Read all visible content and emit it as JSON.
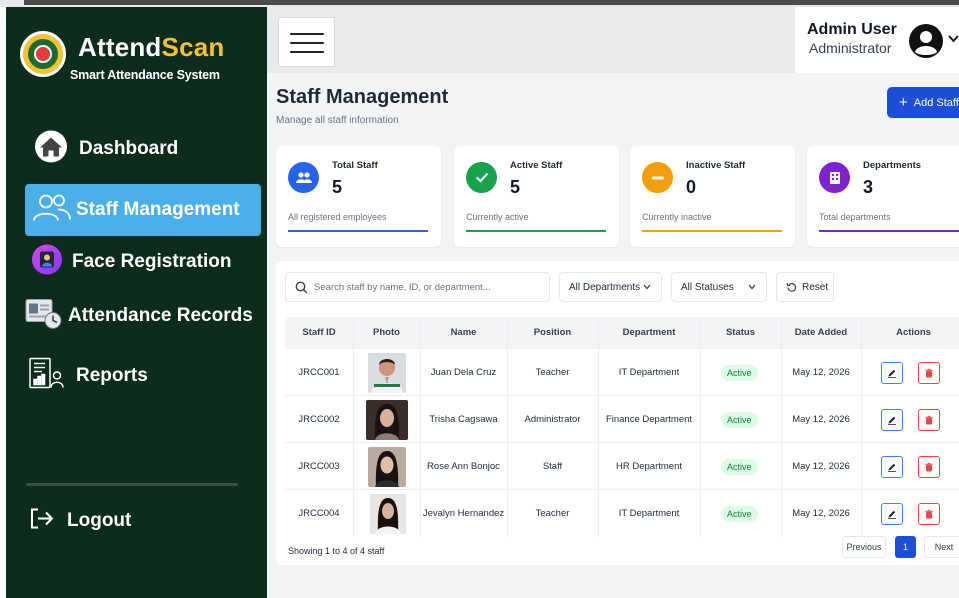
{
  "brand": {
    "name_main": "Attend",
    "name_accent": "Scan",
    "tagline": "Smart Attendance System"
  },
  "sidebar": {
    "items": [
      {
        "label": "Dashboard",
        "icon": "home-icon"
      },
      {
        "label": "Staff Management",
        "icon": "users-icon",
        "active": true
      },
      {
        "label": "Face Registration",
        "icon": "face-scan-icon"
      },
      {
        "label": "Attendance Records",
        "icon": "attendance-records-icon"
      },
      {
        "label": "Reports",
        "icon": "reports-icon"
      }
    ],
    "logout": "Logout"
  },
  "header": {
    "user_name": "Admin User",
    "user_role": "Administrator"
  },
  "page": {
    "title": "Staff Management",
    "subtitle": "Manage all staff information",
    "add_button": "Add Staff"
  },
  "stats": [
    {
      "title": "Total Staff",
      "value": "5",
      "desc": "All registered employees",
      "color": "#2563eb",
      "icon": "users-icon"
    },
    {
      "title": "Active Staff",
      "value": "5",
      "desc": "Currently active",
      "color": "#16a34a",
      "icon": "check-icon"
    },
    {
      "title": "Inactive Staff",
      "value": "0",
      "desc": "Currently inactive",
      "color": "#f59e0b",
      "icon": "minus-icon"
    },
    {
      "title": "Departments",
      "value": "3",
      "desc": "Total departments",
      "color": "#7e22ce",
      "icon": "building-icon"
    }
  ],
  "filters": {
    "search_placeholder": "Search staff by name, ID, or department...",
    "department": "All Departments",
    "status": "All Statuses",
    "reset": "Reset"
  },
  "table": {
    "columns": [
      "Staff ID",
      "Photo",
      "Name",
      "Position",
      "Department",
      "Status",
      "Date Added",
      "Actions"
    ],
    "rows": [
      {
        "id": "JRCC001",
        "name": "Juan Dela Cruz",
        "position": "Teacher",
        "department": "IT Department",
        "status": "Active",
        "date": "May 12, 2026"
      },
      {
        "id": "JRCC002",
        "name": "Trisha Cagsawa",
        "position": "Administrator",
        "department": "Finance Department",
        "status": "Active",
        "date": "May 12, 2026"
      },
      {
        "id": "JRCC003",
        "name": "Rose Ann Bonjoc",
        "position": "Staff",
        "department": "HR Department",
        "status": "Active",
        "date": "May 12, 2026"
      },
      {
        "id": "JRCC004",
        "name": "Jevalyn Hernandez",
        "position": "Teacher",
        "department": "IT Department",
        "status": "Active",
        "date": "May 12, 2026"
      }
    ]
  },
  "pagination": {
    "showing": "Showing 1 to 4 of 4 staff",
    "prev": "Previous",
    "current": "1",
    "next": "Next"
  }
}
